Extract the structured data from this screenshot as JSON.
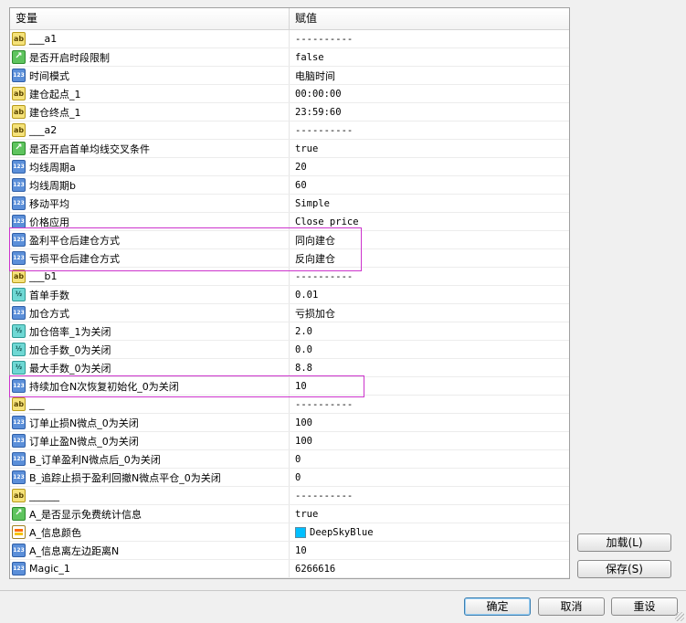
{
  "header": {
    "col_variable": "变量",
    "col_value": "赋值"
  },
  "rows": [
    {
      "icon": "ab",
      "name": "___a1",
      "value": "----------"
    },
    {
      "icon": "bool",
      "name": "是否开启时段限制",
      "value": "false"
    },
    {
      "icon": "num",
      "name": "时间模式",
      "value": "电脑时间"
    },
    {
      "icon": "ab",
      "name": "建仓起点_1",
      "value": "00:00:00"
    },
    {
      "icon": "ab",
      "name": "建仓终点_1",
      "value": "23:59:60"
    },
    {
      "icon": "ab",
      "name": "___a2",
      "value": "----------"
    },
    {
      "icon": "bool",
      "name": "是否开启首单均线交叉条件",
      "value": "true"
    },
    {
      "icon": "num",
      "name": "均线周期a",
      "value": "20"
    },
    {
      "icon": "num",
      "name": "均线周期b",
      "value": "60"
    },
    {
      "icon": "num",
      "name": "移动平均",
      "value": "Simple"
    },
    {
      "icon": "num",
      "name": "价格应用",
      "value": "Close price"
    },
    {
      "icon": "num",
      "name": "盈利平仓后建仓方式",
      "value": "同向建仓"
    },
    {
      "icon": "num",
      "name": "亏损平仓后建仓方式",
      "value": "反向建仓"
    },
    {
      "icon": "ab",
      "name": "___b1",
      "value": "----------"
    },
    {
      "icon": "dbl",
      "name": "首单手数",
      "value": "0.01"
    },
    {
      "icon": "num",
      "name": "加仓方式",
      "value": "亏损加仓"
    },
    {
      "icon": "dbl",
      "name": "加仓倍率_1为关闭",
      "value": "2.0"
    },
    {
      "icon": "dbl",
      "name": "加仓手数_0为关闭",
      "value": "0.0"
    },
    {
      "icon": "dbl",
      "name": "最大手数_0为关闭",
      "value": "8.8"
    },
    {
      "icon": "num",
      "name": "持续加仓N次恢复初始化_0为关闭",
      "value": "10"
    },
    {
      "icon": "ab",
      "name": "___",
      "value": "----------"
    },
    {
      "icon": "num",
      "name": "订单止损N微点_0为关闭",
      "value": "100"
    },
    {
      "icon": "num",
      "name": "订单止盈N微点_0为关闭",
      "value": "100"
    },
    {
      "icon": "num",
      "name": "B_订单盈利N微点后_0为关闭",
      "value": "0"
    },
    {
      "icon": "num",
      "name": "B_追踪止损于盈利回撤N微点平仓_0为关闭",
      "value": "0"
    },
    {
      "icon": "ab",
      "name": "______",
      "value": "----------"
    },
    {
      "icon": "bool",
      "name": "A_是否显示免费统计信息",
      "value": "true"
    },
    {
      "icon": "clr",
      "name": "A_信息颜色",
      "value": "DeepSkyBlue",
      "swatch": "#00bfff"
    },
    {
      "icon": "num",
      "name": "A_信息离左边距离N",
      "value": "10"
    },
    {
      "icon": "num",
      "name": "Magic_1",
      "value": "6266616"
    }
  ],
  "icons": {
    "ab": {
      "name": "string-type-icon",
      "glyph": "ab"
    },
    "bool": {
      "name": "bool-type-icon",
      "glyph": "↗"
    },
    "num": {
      "name": "integer-type-icon",
      "glyph": "123"
    },
    "dbl": {
      "name": "double-type-icon",
      "glyph": "½"
    },
    "clr": {
      "name": "color-type-icon",
      "glyph": ""
    }
  },
  "side_buttons": {
    "load": "加载(L)",
    "save": "保存(S)"
  },
  "bottom_buttons": {
    "ok": "确定",
    "cancel": "取消",
    "reset": "重设"
  },
  "colors": {
    "highlight": "#cc33cc",
    "deepskyblue": "#00bfff"
  }
}
